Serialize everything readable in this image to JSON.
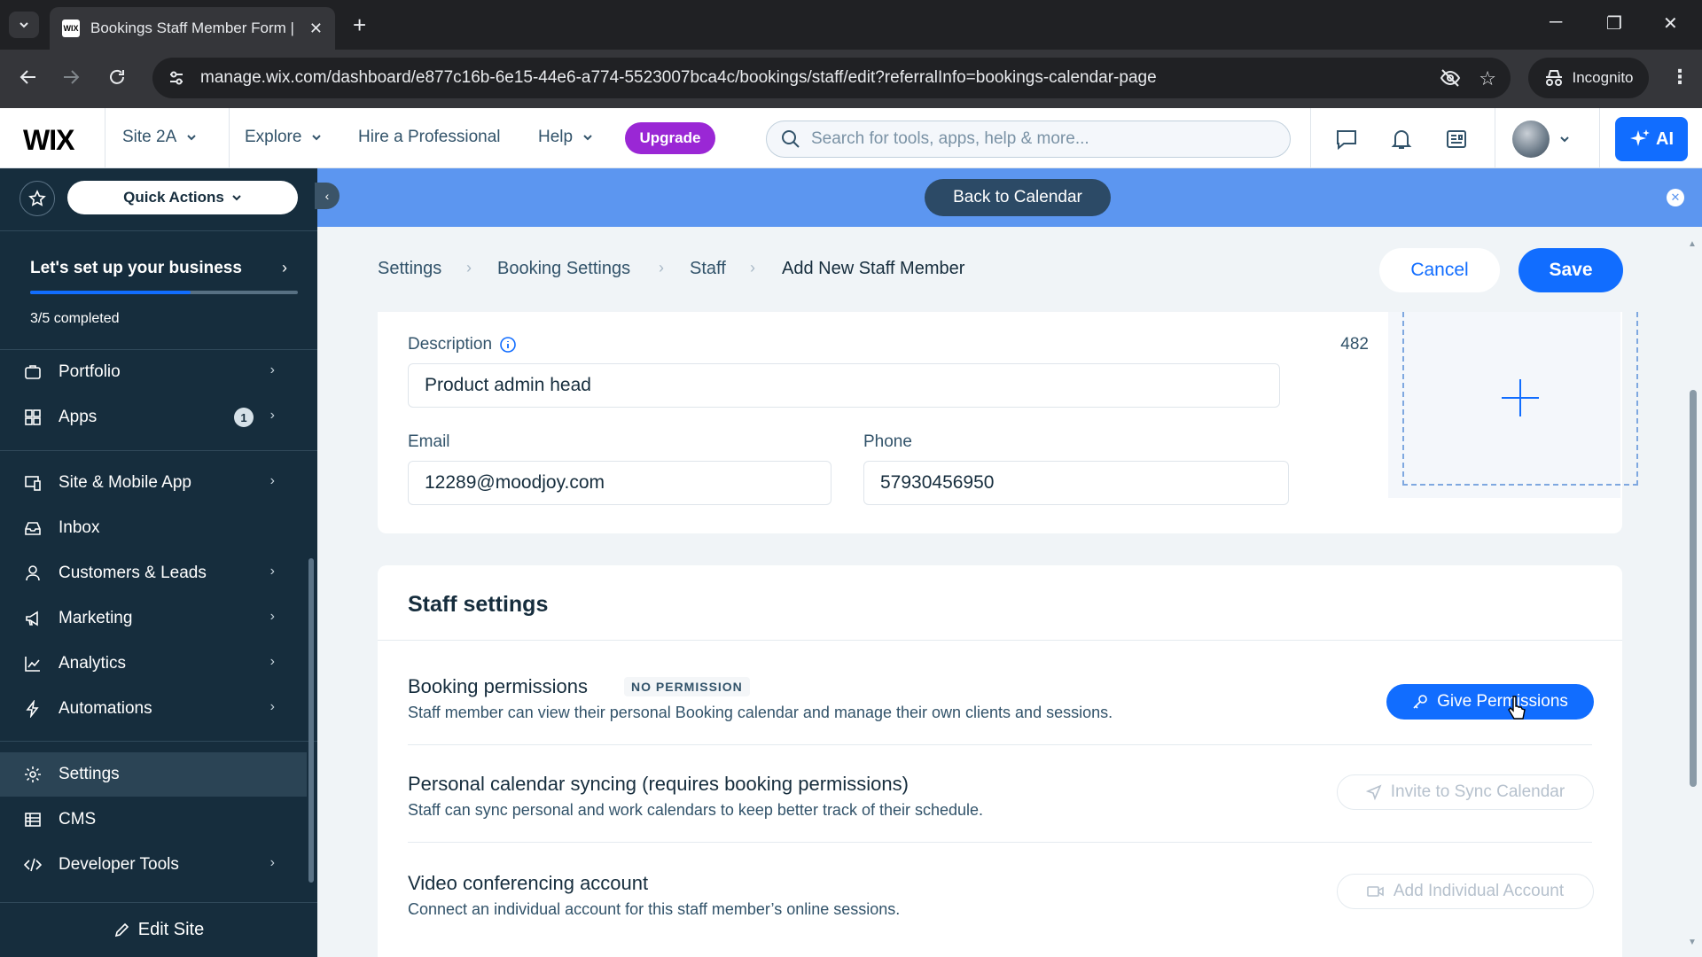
{
  "browser": {
    "tab_title": "Bookings Staff Member Form |",
    "tab_favicon": "WIX",
    "url": "manage.wix.com/dashboard/e877c16b-6e15-44e6-a774-5523007bca4c/bookings/staff/edit?referralInfo=bookings-calendar-page",
    "incognito_label": "Incognito"
  },
  "header": {
    "logo": "WIX",
    "site_name": "Site 2A",
    "explore": "Explore",
    "hire": "Hire a Professional",
    "help": "Help",
    "upgrade": "Upgrade",
    "search_placeholder": "Search for tools, apps, help & more...",
    "ai_label": "AI",
    "accent_color": "#116dff",
    "upgrade_color": "#9a27d5"
  },
  "sidebar": {
    "quick_actions": "Quick Actions",
    "setup_title": "Let's set up your business",
    "setup_progress": 0.6,
    "setup_count": "3/5 completed",
    "items": [
      {
        "label": "Portfolio",
        "icon": "portfolio-icon"
      },
      {
        "label": "Apps",
        "icon": "apps-icon",
        "badge": "1"
      },
      {
        "label": "Site & Mobile App",
        "icon": "site-mobile-icon"
      },
      {
        "label": "Inbox",
        "icon": "inbox-icon"
      },
      {
        "label": "Customers & Leads",
        "icon": "customers-icon"
      },
      {
        "label": "Marketing",
        "icon": "megaphone-icon"
      },
      {
        "label": "Analytics",
        "icon": "analytics-icon"
      },
      {
        "label": "Automations",
        "icon": "lightning-icon"
      },
      {
        "label": "Settings",
        "icon": "gear-icon"
      },
      {
        "label": "CMS",
        "icon": "cms-icon"
      },
      {
        "label": "Developer Tools",
        "icon": "code-icon"
      }
    ],
    "edit_site": "Edit Site",
    "bg_color": "#162d3d"
  },
  "banner": {
    "back_to_calendar": "Back to Calendar"
  },
  "breadcrumb": [
    "Settings",
    "Booking Settings",
    "Staff",
    "Add New Staff Member"
  ],
  "actions": {
    "cancel": "Cancel",
    "save": "Save"
  },
  "form": {
    "description_label": "Description",
    "description_count": "482",
    "description_value": "Product admin head",
    "email_label": "Email",
    "email_value": "12289@moodjoy.com",
    "phone_label": "Phone",
    "phone_value": "57930456950"
  },
  "staff_settings": {
    "title": "Staff settings",
    "booking_permissions": {
      "title": "Booking permissions",
      "badge": "NO PERMISSION",
      "description": "Staff member can view their personal Booking calendar and manage their own clients and sessions.",
      "button": "Give Permissions"
    },
    "calendar_sync": {
      "title": "Personal calendar syncing (requires booking permissions)",
      "description": "Staff can sync personal and work calendars to keep better track of their schedule.",
      "button": "Invite to Sync Calendar"
    },
    "video": {
      "title": "Video conferencing account",
      "description": "Connect an individual account for this staff member’s online sessions.",
      "button": "Add Individual Account"
    }
  }
}
